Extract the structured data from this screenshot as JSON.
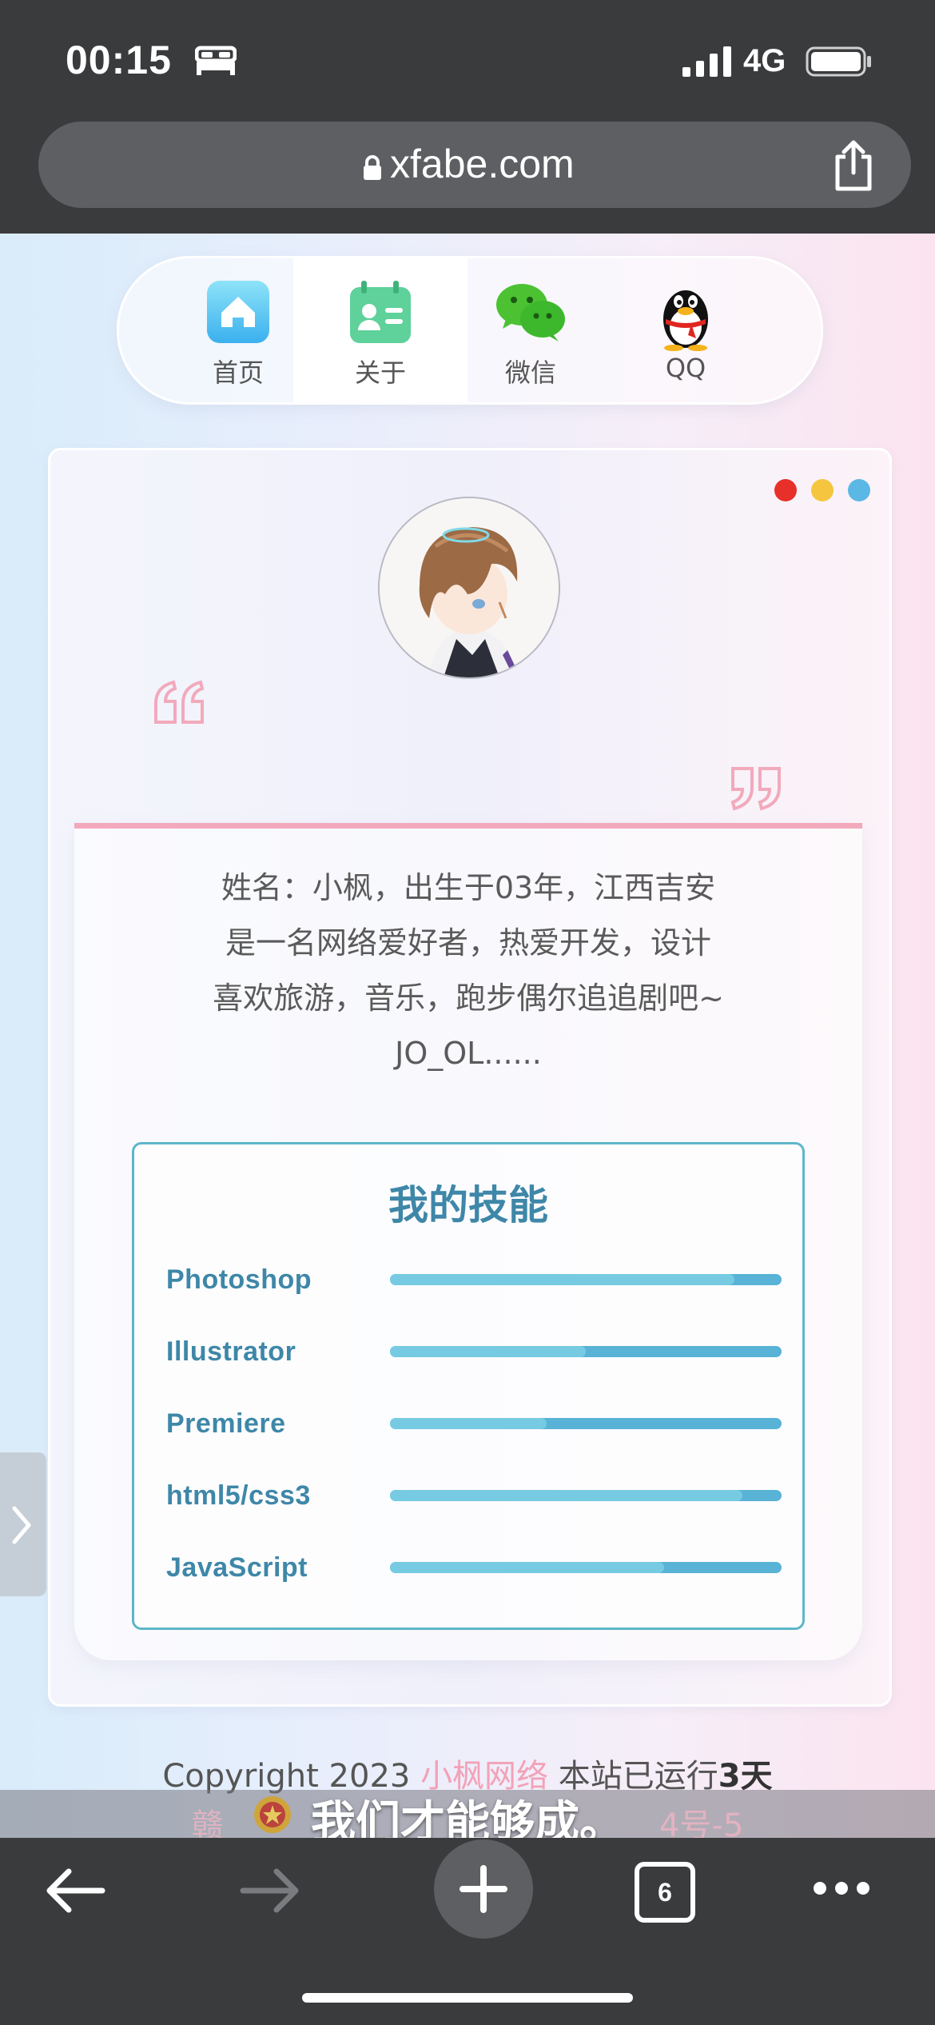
{
  "status_bar": {
    "time": "00:15",
    "network": "4G"
  },
  "browser": {
    "url": "xfabe.com",
    "tabs_count": "6"
  },
  "nav": {
    "items": [
      {
        "label": "首页",
        "icon": "home-icon"
      },
      {
        "label": "关于",
        "icon": "profile-card-icon"
      },
      {
        "label": "微信",
        "icon": "wechat-icon"
      },
      {
        "label": "QQ",
        "icon": "qq-penguin-icon"
      }
    ],
    "active": "关于"
  },
  "profile": {
    "bio_lines": [
      "姓名：小枫，出生于03年，江西吉安",
      "是一名网络爱好者，热爱开发，设计",
      "喜欢旅游，音乐，跑步偶尔追追剧吧~",
      "JO_OL......"
    ]
  },
  "skills": {
    "title": "我的技能",
    "items": [
      {
        "name": "Photoshop",
        "level": 0.88
      },
      {
        "name": "Illustrator",
        "level": 0.5
      },
      {
        "name": "Premiere",
        "level": 0.4
      },
      {
        "name": "html5/css3",
        "level": 0.9
      },
      {
        "name": "JavaScript",
        "level": 0.7
      }
    ]
  },
  "footer": {
    "copyright_prefix": "Copyright 2023",
    "brand": "小枫网络",
    "running_prefix": "本站已运行",
    "running_days": "3天",
    "icp_fragment": "赣",
    "icp_suffix": "4号-5"
  },
  "overlay_subtitle": "我们才能够成。",
  "colors": {
    "accent_pink": "#f2a9bc",
    "accent_teal": "#5db6c9",
    "skill_text": "#3e87a8",
    "dot_red": "#e8302a",
    "dot_yellow": "#f5c53f",
    "dot_blue": "#5bb8e4"
  }
}
